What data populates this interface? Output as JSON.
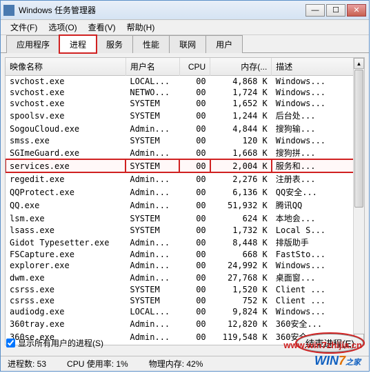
{
  "window": {
    "title": "Windows 任务管理器"
  },
  "menu": {
    "file": "文件(F)",
    "options": "选项(O)",
    "view": "查看(V)",
    "help": "帮助(H)"
  },
  "tabs": {
    "apps": "应用程序",
    "processes": "进程",
    "services": "服务",
    "performance": "性能",
    "network": "联网",
    "users": "用户"
  },
  "columns": {
    "name": "映像名称",
    "user": "用户名",
    "cpu": "CPU",
    "mem": "内存(...",
    "desc": "描述"
  },
  "rows": [
    {
      "name": "svchost.exe",
      "user": "LOCAL...",
      "cpu": "00",
      "mem": "4,868 K",
      "desc": "Windows..."
    },
    {
      "name": "svchost.exe",
      "user": "NETWO...",
      "cpu": "00",
      "mem": "1,724 K",
      "desc": "Windows..."
    },
    {
      "name": "svchost.exe",
      "user": "SYSTEM",
      "cpu": "00",
      "mem": "1,652 K",
      "desc": "Windows..."
    },
    {
      "name": "spoolsv.exe",
      "user": "SYSTEM",
      "cpu": "00",
      "mem": "1,244 K",
      "desc": "后台处..."
    },
    {
      "name": "SogouCloud.exe",
      "user": "Admin...",
      "cpu": "00",
      "mem": "4,844 K",
      "desc": "搜狗输..."
    },
    {
      "name": "smss.exe",
      "user": "SYSTEM",
      "cpu": "00",
      "mem": "120 K",
      "desc": "Windows..."
    },
    {
      "name": "SGImeGuard.exe",
      "user": "Admin...",
      "cpu": "00",
      "mem": "1,668 K",
      "desc": "搜狗拼..."
    },
    {
      "name": "services.exe",
      "user": "SYSTEM",
      "cpu": "00",
      "mem": "2,004 K",
      "desc": "服务和...",
      "hl": true
    },
    {
      "name": "regedit.exe",
      "user": "Admin...",
      "cpu": "00",
      "mem": "2,276 K",
      "desc": "注册表..."
    },
    {
      "name": "QQProtect.exe",
      "user": "Admin...",
      "cpu": "00",
      "mem": "6,136 K",
      "desc": "QQ安全..."
    },
    {
      "name": "QQ.exe",
      "user": "Admin...",
      "cpu": "00",
      "mem": "51,932 K",
      "desc": "腾讯QQ"
    },
    {
      "name": "lsm.exe",
      "user": "SYSTEM",
      "cpu": "00",
      "mem": "624 K",
      "desc": "本地会..."
    },
    {
      "name": "lsass.exe",
      "user": "SYSTEM",
      "cpu": "00",
      "mem": "1,732 K",
      "desc": "Local S..."
    },
    {
      "name": "Gidot Typesetter.exe",
      "user": "Admin...",
      "cpu": "00",
      "mem": "8,448 K",
      "desc": "排版助手"
    },
    {
      "name": "FSCapture.exe",
      "user": "Admin...",
      "cpu": "00",
      "mem": "668 K",
      "desc": "FastSto..."
    },
    {
      "name": "explorer.exe",
      "user": "Admin...",
      "cpu": "00",
      "mem": "24,992 K",
      "desc": "Windows..."
    },
    {
      "name": "dwm.exe",
      "user": "Admin...",
      "cpu": "00",
      "mem": "27,768 K",
      "desc": "桌面窗..."
    },
    {
      "name": "csrss.exe",
      "user": "SYSTEM",
      "cpu": "00",
      "mem": "1,520 K",
      "desc": "Client ..."
    },
    {
      "name": "csrss.exe",
      "user": "SYSTEM",
      "cpu": "00",
      "mem": "752 K",
      "desc": "Client ..."
    },
    {
      "name": "audiodg.exe",
      "user": "LOCAL...",
      "cpu": "00",
      "mem": "9,824 K",
      "desc": "Windows..."
    },
    {
      "name": "360tray.exe",
      "user": "Admin...",
      "cpu": "00",
      "mem": "12,820 K",
      "desc": "360安全..."
    },
    {
      "name": "360se.exe",
      "user": "Admin...",
      "cpu": "00",
      "mem": "119,548 K",
      "desc": "360安全..."
    }
  ],
  "showAll": "显示所有用户的进程(S)",
  "endProcess": "结束进程(E)",
  "status": {
    "procs": "进程数: 53",
    "cpu": "CPU 使用率: 1%",
    "mem": "物理内存: 42%"
  },
  "watermark": "www.win7zhijia.cn"
}
